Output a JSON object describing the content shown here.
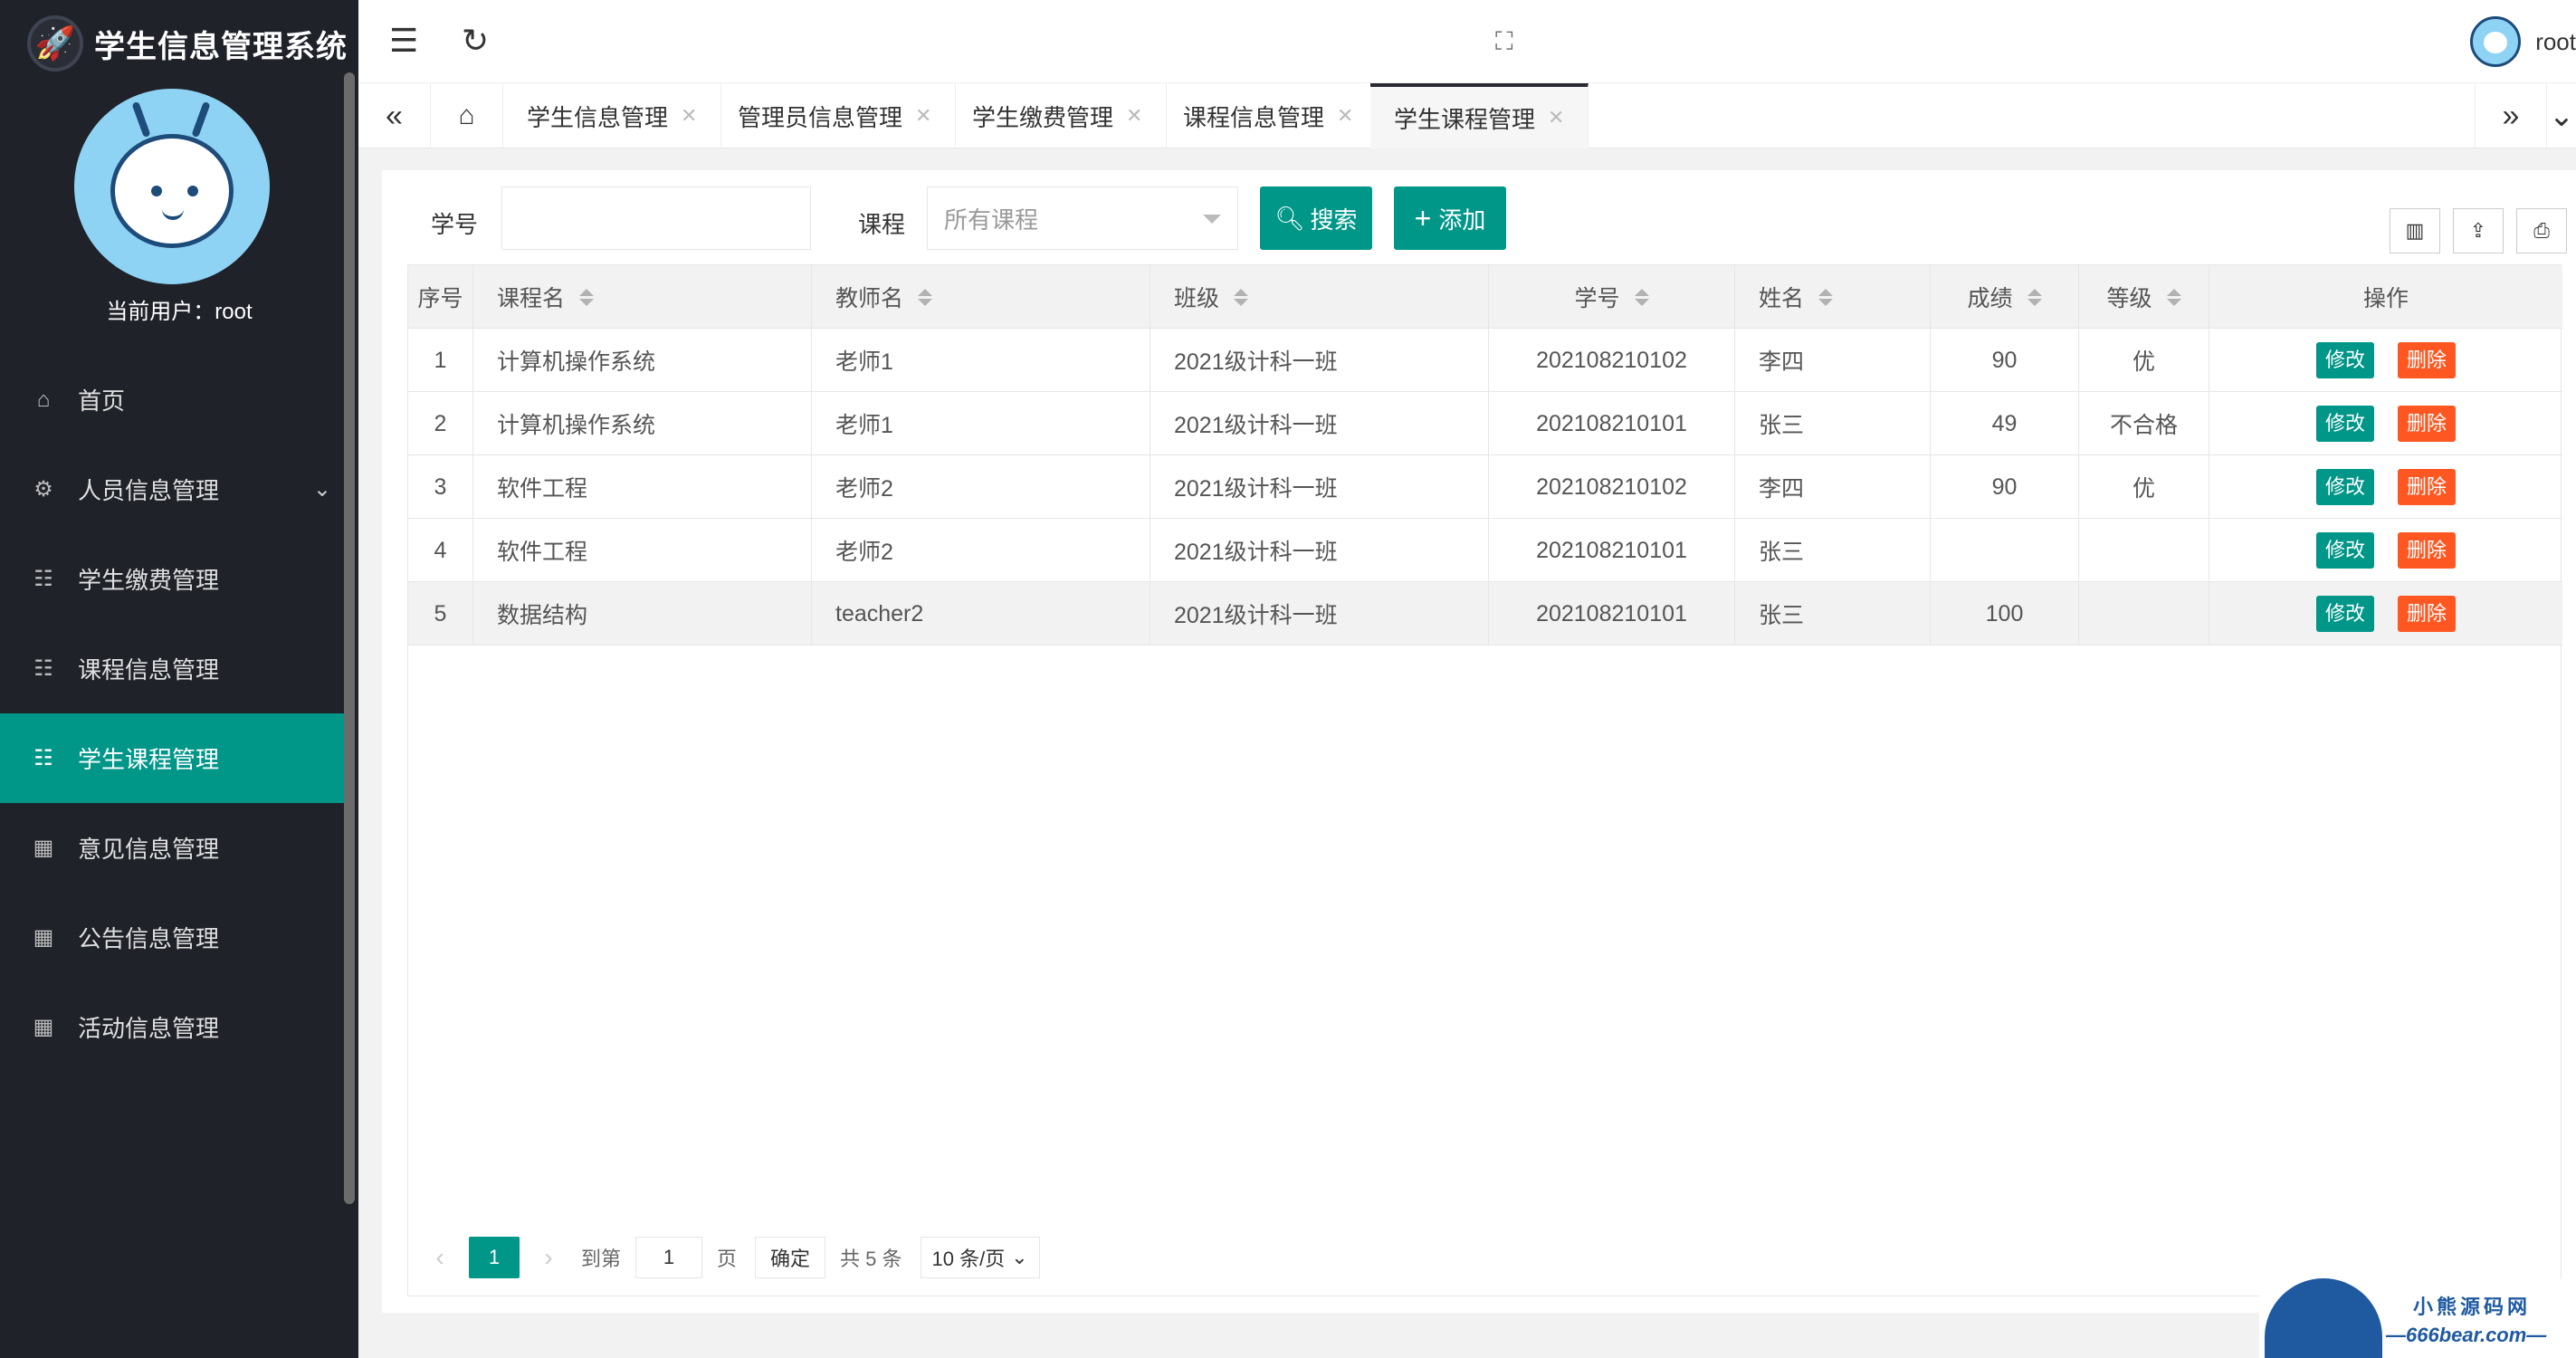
{
  "app": {
    "title": "学生信息管理系统",
    "current_user_label": "当前用户：root",
    "header_username": "root"
  },
  "sidebar": {
    "items": [
      {
        "label": "首页",
        "icon": "home-icon",
        "active": false
      },
      {
        "label": "人员信息管理",
        "icon": "gear-icon",
        "active": false,
        "expandable": true
      },
      {
        "label": "学生缴费管理",
        "icon": "list-icon",
        "active": false
      },
      {
        "label": "课程信息管理",
        "icon": "list-icon",
        "active": false
      },
      {
        "label": "学生课程管理",
        "icon": "list-icon",
        "active": true
      },
      {
        "label": "意见信息管理",
        "icon": "grid-icon",
        "active": false
      },
      {
        "label": "公告信息管理",
        "icon": "grid-icon",
        "active": false
      },
      {
        "label": "活动信息管理",
        "icon": "grid-icon",
        "active": false
      }
    ]
  },
  "tabs": [
    {
      "label": "学生信息管理",
      "active": false
    },
    {
      "label": "管理员信息管理",
      "active": false
    },
    {
      "label": "学生缴费管理",
      "active": false
    },
    {
      "label": "课程信息管理",
      "active": false
    },
    {
      "label": "学生课程管理",
      "active": true
    }
  ],
  "filters": {
    "student_no_label": "学号",
    "student_no_value": "",
    "course_label": "课程",
    "course_selected": "所有课程",
    "search_label": "搜索",
    "add_label": "添加"
  },
  "table": {
    "columns": [
      "序号",
      "课程名",
      "教师名",
      "班级",
      "学号",
      "姓名",
      "成绩",
      "等级",
      "操作"
    ],
    "rows": [
      {
        "no": "1",
        "course": "计算机操作系统",
        "teacher": "老师1",
        "class": "2021级计科一班",
        "student_no": "202108210102",
        "name": "李四",
        "score": "90",
        "grade": "优"
      },
      {
        "no": "2",
        "course": "计算机操作系统",
        "teacher": "老师1",
        "class": "2021级计科一班",
        "student_no": "202108210101",
        "name": "张三",
        "score": "49",
        "grade": "不合格"
      },
      {
        "no": "3",
        "course": "软件工程",
        "teacher": "老师2",
        "class": "2021级计科一班",
        "student_no": "202108210102",
        "name": "李四",
        "score": "90",
        "grade": "优"
      },
      {
        "no": "4",
        "course": "软件工程",
        "teacher": "老师2",
        "class": "2021级计科一班",
        "student_no": "202108210101",
        "name": "张三",
        "score": "",
        "grade": ""
      },
      {
        "no": "5",
        "course": "数据结构",
        "teacher": "teacher2",
        "class": "2021级计科一班",
        "student_no": "202108210101",
        "name": "张三",
        "score": "100",
        "grade": ""
      }
    ],
    "edit_label": "修改",
    "delete_label": "删除"
  },
  "pagination": {
    "current_page": "1",
    "goto_label": "到第",
    "goto_value": "1",
    "page_unit": "页",
    "confirm_label": "确定",
    "total_label": "共 5 条",
    "page_size": "10 条/页"
  },
  "watermark": {
    "line1": "小熊源码网",
    "line2": "—666bear.com—"
  },
  "colors": {
    "sidebar_bg": "#20222a",
    "accent": "#009688",
    "danger": "#ff5722"
  }
}
